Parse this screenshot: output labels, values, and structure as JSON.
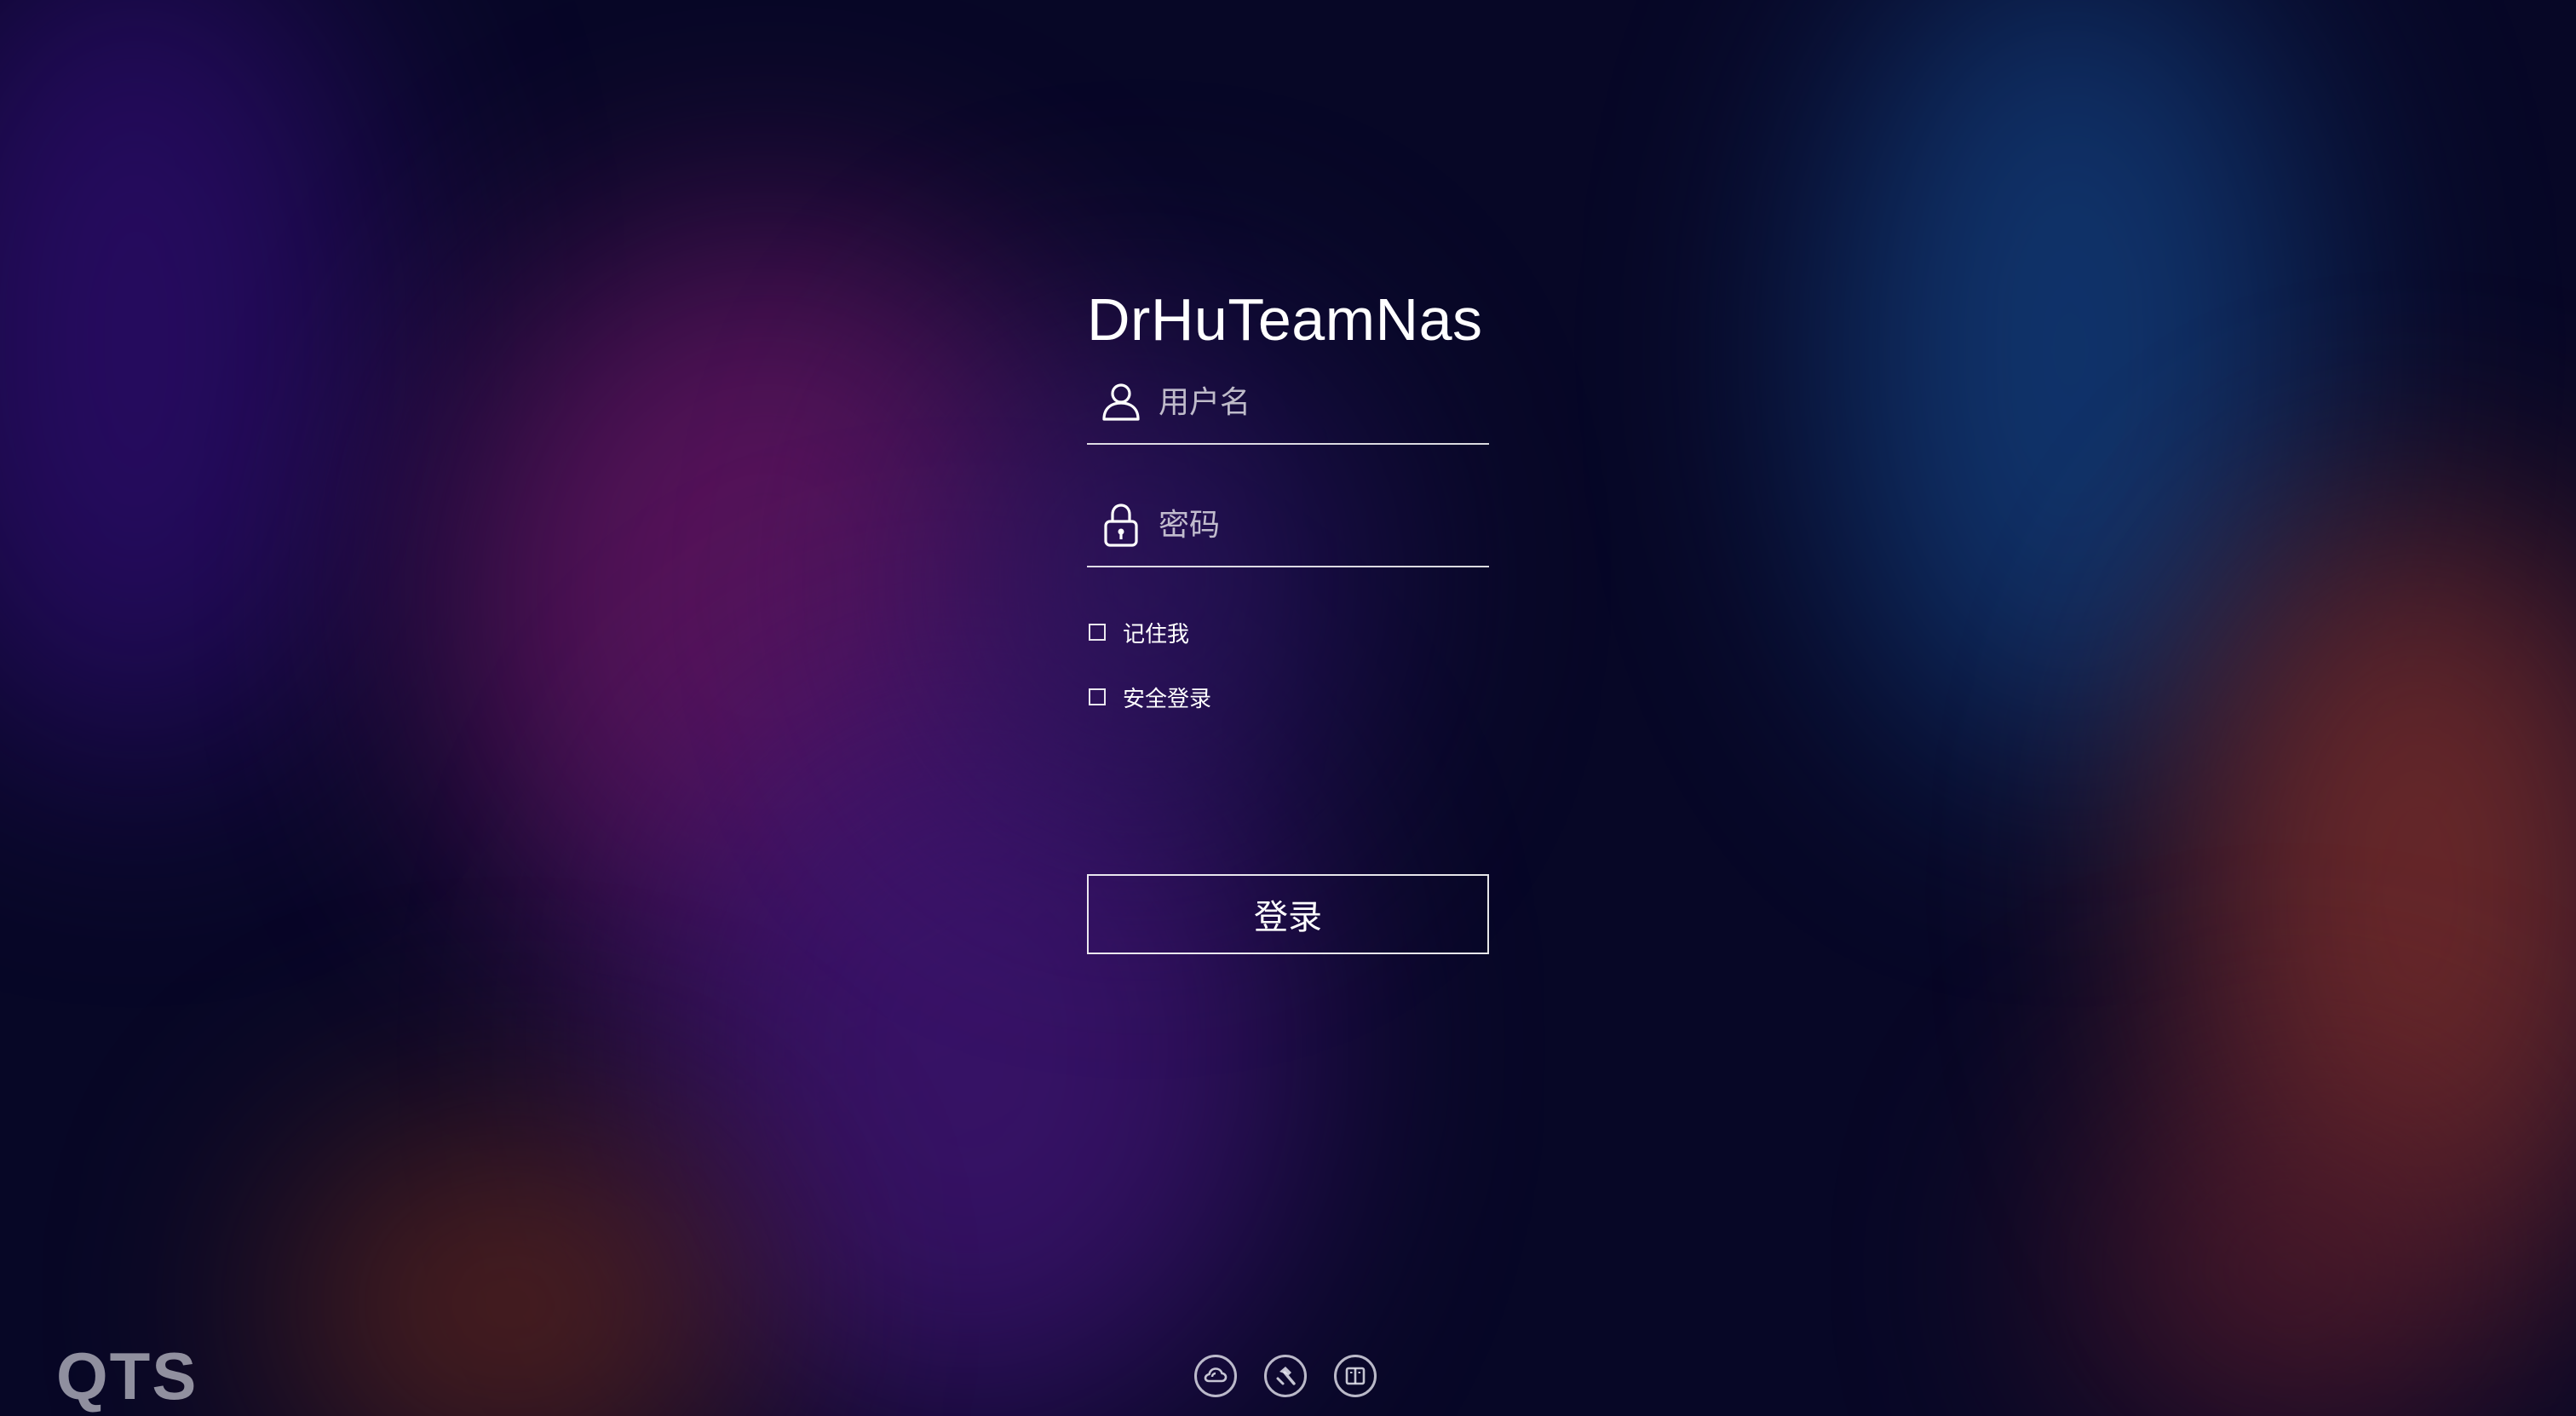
{
  "app": {
    "title": "DrHuTeamNas",
    "brand": "QTS"
  },
  "form": {
    "username_placeholder": "用户名",
    "password_placeholder": "密码",
    "remember_me_label": "记住我",
    "secure_login_label": "安全登录",
    "login_button_label": "登录"
  },
  "icons": {
    "username": "user-icon",
    "password": "lock-icon",
    "footer": [
      "cloud-link-icon",
      "helpdesk-tool-icon",
      "manual-book-icon"
    ]
  },
  "colors": {
    "background": "#070726",
    "text": "#ffffff"
  }
}
